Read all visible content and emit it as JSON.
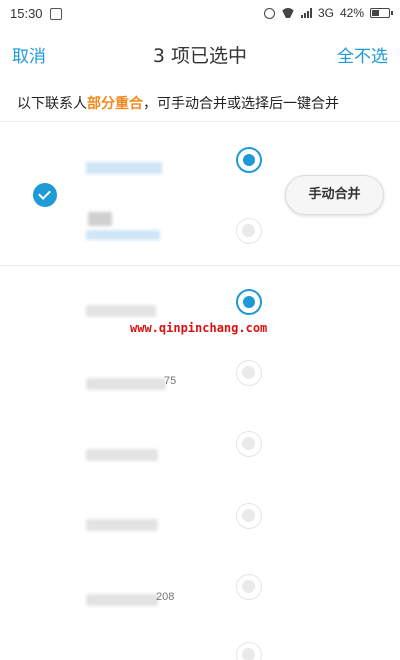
{
  "status_bar": {
    "time": "15:30",
    "network": "3G",
    "battery": "42%",
    "battery_level": 0.42,
    "icons": [
      "screenshot-icon",
      "alarm-icon",
      "wifi-icon",
      "signal-icon",
      "battery-icon"
    ]
  },
  "nav": {
    "cancel_label": "取消",
    "title": "3 项已选中",
    "deselect_all_label": "全不选"
  },
  "info": {
    "prefix": "以下联系人",
    "highlight": "部分重合",
    "suffix": "，可手动合并或选择后一键合并"
  },
  "group": {
    "checked": true,
    "merge_button_label": "手动合并",
    "contacts": [
      {
        "blurred": true,
        "selected": true
      },
      {
        "blurred": true,
        "selected": false
      }
    ]
  },
  "group2": {
    "contacts": [
      {
        "blurred": true,
        "tail": "",
        "selected": true
      },
      {
        "blurred": true,
        "tail": "75",
        "selected": false
      },
      {
        "blurred": true,
        "tail": "",
        "selected": false
      },
      {
        "blurred": true,
        "tail": "",
        "selected": false
      },
      {
        "blurred": true,
        "tail": "208",
        "selected": false
      },
      {
        "blurred": true,
        "tail": "",
        "selected": false
      }
    ]
  },
  "watermark": "www.qinpinchang.com",
  "colors": {
    "accent": "#1e9ad6",
    "highlight": "#f08a1e",
    "watermark": "#dd1111"
  }
}
